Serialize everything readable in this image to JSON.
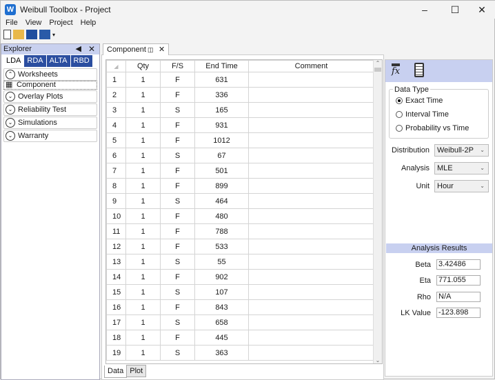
{
  "app": {
    "icon": "W",
    "title": "Weibull Toolbox - Project"
  },
  "menu": [
    "File",
    "View",
    "Project",
    "Help"
  ],
  "explorer": {
    "title": "Explorer",
    "tabs": [
      "LDA",
      "RDA",
      "ALTA",
      "RBD"
    ],
    "groups": [
      {
        "label": "Worksheets",
        "expanded": true,
        "children": [
          "Component"
        ]
      },
      {
        "label": "Overlay Plots"
      },
      {
        "label": "Reliability Test"
      },
      {
        "label": "Simulations"
      },
      {
        "label": "Warranty"
      }
    ]
  },
  "document": {
    "tab": "Component",
    "bottom_tabs": [
      "Data",
      "Plot"
    ]
  },
  "grid": {
    "columns": [
      "Qty",
      "F/S",
      "End Time",
      "Comment"
    ],
    "rows": [
      [
        "1",
        "1",
        "F",
        "631"
      ],
      [
        "2",
        "1",
        "F",
        "336"
      ],
      [
        "3",
        "1",
        "S",
        "165"
      ],
      [
        "4",
        "1",
        "F",
        "931"
      ],
      [
        "5",
        "1",
        "F",
        "1012"
      ],
      [
        "6",
        "1",
        "S",
        "67"
      ],
      [
        "7",
        "1",
        "F",
        "501"
      ],
      [
        "8",
        "1",
        "F",
        "899"
      ],
      [
        "9",
        "1",
        "S",
        "464"
      ],
      [
        "10",
        "1",
        "F",
        "480"
      ],
      [
        "11",
        "1",
        "F",
        "788"
      ],
      [
        "12",
        "1",
        "F",
        "533"
      ],
      [
        "13",
        "1",
        "S",
        "55"
      ],
      [
        "14",
        "1",
        "F",
        "902"
      ],
      [
        "15",
        "1",
        "S",
        "107"
      ],
      [
        "16",
        "1",
        "F",
        "843"
      ],
      [
        "17",
        "1",
        "S",
        "658"
      ],
      [
        "18",
        "1",
        "F",
        "445"
      ],
      [
        "19",
        "1",
        "S",
        "363"
      ]
    ]
  },
  "panel": {
    "data_type_label": "Data Type",
    "data_types": [
      "Exact Time",
      "Interval Time",
      "Probability vs Time"
    ],
    "selected_type": 0,
    "distribution_label": "Distribution",
    "distribution": "Weibull-2P",
    "analysis_label": "Analysis",
    "analysis": "MLE",
    "unit_label": "Unit",
    "unit": "Hour"
  },
  "results": {
    "title": "Analysis Results",
    "beta_label": "Beta",
    "beta": "3.42486",
    "eta_label": "Eta",
    "eta": "771.055",
    "rho_label": "Rho",
    "rho": "N/A",
    "lk_label": "LK Value",
    "lk": "-123.898"
  }
}
